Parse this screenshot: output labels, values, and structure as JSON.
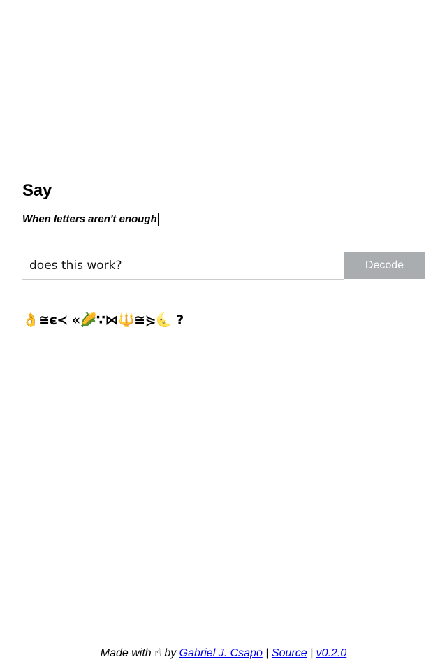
{
  "app": {
    "title": "Say",
    "tagline": "When letters aren't enough"
  },
  "form": {
    "input_value": "does this work?",
    "decode_label": "Decode"
  },
  "output": {
    "encoded": "👌≅є≺ «🌽∵⋈🔱≅⋟🌜 ?"
  },
  "footer": {
    "made_with": "Made with",
    "heart_icon": "☝",
    "by": "by",
    "author_link": "Gabriel J. Csapo",
    "separator": "|",
    "source_link": "Source",
    "version_link": "v0.2.0"
  },
  "colors": {
    "button_bg": "#a9adaf",
    "input_border": "#cccccc",
    "link": "#0000ee"
  }
}
